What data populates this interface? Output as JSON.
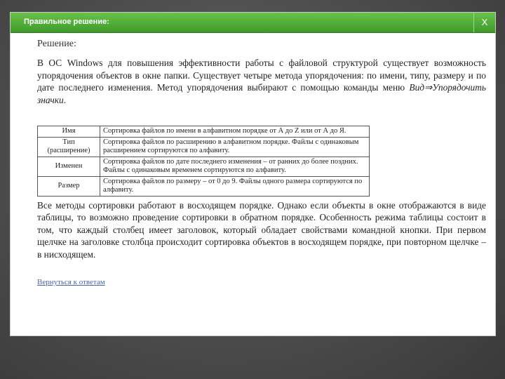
{
  "dialog": {
    "title": "Правильное решение:",
    "close_label": "X"
  },
  "content": {
    "heading": "Решение:",
    "intro_before_italic": "В ОС Windows для повышения эффективности работы с файловой структурой существует возможность упорядочения объектов в окне папки. Существует четыре метода упорядочения: по имени, типу, размеру и по дате последнего изменения. Метод упорядочения выбирают с помощью команды меню ",
    "intro_italic": "Вид⇒Упорядочить значки",
    "intro_after_italic": ".",
    "table": [
      {
        "name": "Имя",
        "desc": "Сортировка файлов по имени в алфавитном порядке от А до Z или от А до Я."
      },
      {
        "name": "Тип (расширение)",
        "desc": "Сортировка файлов по расширению в алфавитном порядке. Файлы с одинаковым расширением сортируются по алфавиту."
      },
      {
        "name": "Изменен",
        "desc": "Сортировка файлов по дате последнего изменения – от ранних до более поздних. Файлы с одинаковым временем сортируются по алфавиту."
      },
      {
        "name": "Размер",
        "desc": "Сортировка файлов по размеру – от 0 до 9. Файлы одного размера сортируются по алфавиту."
      }
    ],
    "conclusion": "Все методы сортировки работают в восходящем порядке. Однако если объекты в окне отображаются в виде таблицы, то возможно проведение сортировки в обратном порядке. Особенность режима таблицы состоит в том, что каждый столбец имеет заголовок, который обладает свойствами командной кнопки. При первом щелчке на заголовке столбца происходит сортировка объектов в восходящем порядке, при повторном щелчке – в нисходящем.",
    "back_link": "Вернуться к ответам"
  }
}
